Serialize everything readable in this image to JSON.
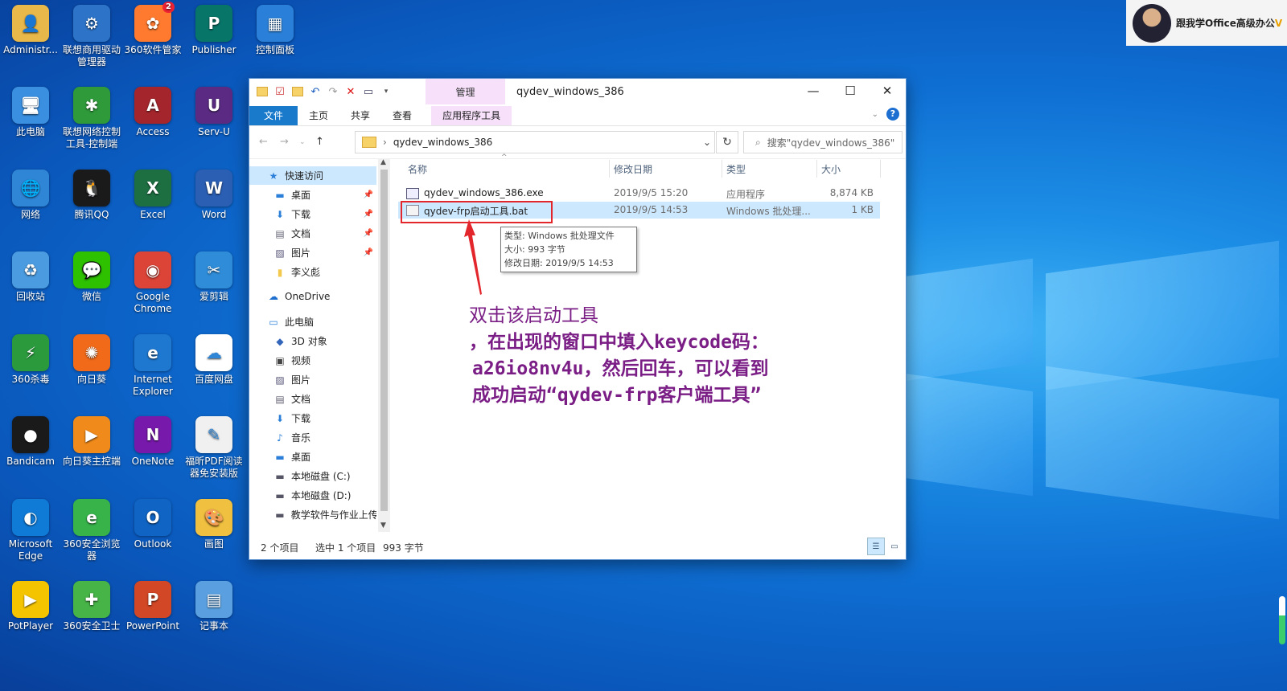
{
  "desktop": {
    "icons": [
      {
        "label": "Administr...",
        "icon": "user-folder-icon",
        "color": "#e9b84a",
        "glyph": "👤"
      },
      {
        "label": "联想商用驱动管理器",
        "icon": "lenovo-driver-icon",
        "color": "#2d74c9",
        "glyph": "⚙"
      },
      {
        "label": "360软件管家",
        "icon": "360-software-manager-icon",
        "color": "#ff7a2f",
        "glyph": "✿",
        "badge": "2"
      },
      {
        "label": "Publisher",
        "icon": "publisher-icon",
        "color": "#077568",
        "glyph": "P"
      },
      {
        "label": "控制面板",
        "icon": "control-panel-icon",
        "color": "#2a80d8",
        "glyph": "▦"
      },
      {
        "label": "此电脑",
        "icon": "this-pc-icon",
        "color": "#3a8fe0",
        "glyph": "🖥"
      },
      {
        "label": "联想网络控制工具-控制端",
        "icon": "lenovo-network-icon",
        "color": "#2e9a3a",
        "glyph": "✱"
      },
      {
        "label": "Access",
        "icon": "access-icon",
        "color": "#a4262c",
        "glyph": "A"
      },
      {
        "label": "Serv-U",
        "icon": "serv-u-icon",
        "color": "#5b2b84",
        "glyph": "U"
      },
      {
        "label": "网络",
        "icon": "network-icon",
        "color": "#2f86d6",
        "glyph": "🌐"
      },
      {
        "label": "腾讯QQ",
        "icon": "qq-icon",
        "color": "#1a1a1a",
        "glyph": "🐧"
      },
      {
        "label": "Excel",
        "icon": "excel-icon",
        "color": "#1d6f42",
        "glyph": "X"
      },
      {
        "label": "Word",
        "icon": "word-icon",
        "color": "#2b5fb4",
        "glyph": "W"
      },
      {
        "label": "回收站",
        "icon": "recycle-bin-icon",
        "color": "#4a9be0",
        "glyph": "♻"
      },
      {
        "label": "微信",
        "icon": "wechat-icon",
        "color": "#2dc100",
        "glyph": "💬"
      },
      {
        "label": "Google Chrome",
        "icon": "chrome-icon",
        "color": "#db4437",
        "glyph": "◉"
      },
      {
        "label": "爱剪辑",
        "icon": "video-editor-icon",
        "color": "#2f8cd8",
        "glyph": "✂"
      },
      {
        "label": "360杀毒",
        "icon": "360-antivirus-icon",
        "color": "#2b9a3d",
        "glyph": "⚡"
      },
      {
        "label": "向日葵",
        "icon": "sunflower-icon",
        "color": "#f06a1a",
        "glyph": "✺"
      },
      {
        "label": "Internet Explorer",
        "icon": "internet-explorer-icon",
        "color": "#1e78d0",
        "glyph": "e"
      },
      {
        "label": "百度网盘",
        "icon": "baidu-netdisk-icon",
        "color": "#ffffff",
        "glyph": "☁"
      },
      {
        "label": "Bandicam",
        "icon": "bandicam-icon",
        "color": "#1a1a1a",
        "glyph": "●"
      },
      {
        "label": "向日葵主控端",
        "icon": "sunflower-controller-icon",
        "color": "#f08a1a",
        "glyph": "▶"
      },
      {
        "label": "OneNote",
        "icon": "onenote-icon",
        "color": "#7719aa",
        "glyph": "N"
      },
      {
        "label": "福昕PDF阅读器免安装版",
        "icon": "foxit-pdf-icon",
        "color": "#f0f0f0",
        "glyph": "✎"
      },
      {
        "label": "Microsoft Edge",
        "icon": "edge-icon",
        "color": "#0f7bd6",
        "glyph": "◐"
      },
      {
        "label": "360安全浏览器",
        "icon": "360-browser-icon",
        "color": "#37b34a",
        "glyph": "e"
      },
      {
        "label": "Outlook",
        "icon": "outlook-icon",
        "color": "#0f64c4",
        "glyph": "O"
      },
      {
        "label": "画图",
        "icon": "paint-icon",
        "color": "#f0c040",
        "glyph": "🎨"
      },
      {
        "label": "PotPlayer",
        "icon": "potplayer-icon",
        "color": "#f5c400",
        "glyph": "▶"
      },
      {
        "label": "360安全卫士",
        "icon": "360-security-icon",
        "color": "#47b447",
        "glyph": "✚"
      },
      {
        "label": "PowerPoint",
        "icon": "powerpoint-icon",
        "color": "#d24726",
        "glyph": "P"
      },
      {
        "label": "记事本",
        "icon": "notepad-icon",
        "color": "#5aa0e0",
        "glyph": "▤"
      }
    ]
  },
  "presenter": {
    "name_main": "跟我学Office高级办公",
    "name_tail": "V"
  },
  "explorer": {
    "title": "qydev_windows_386",
    "context_tab": "管理",
    "tabs": [
      "文件",
      "主页",
      "共享",
      "查看",
      "应用程序工具"
    ],
    "address": "qydev_windows_386",
    "search_placeholder": "搜索\"qydev_windows_386\"",
    "columns": {
      "name": "名称",
      "date": "修改日期",
      "type": "类型",
      "size": "大小"
    },
    "files": [
      {
        "name": "qydev_windows_386.exe",
        "date": "2019/9/5 15:20",
        "type": "应用程序",
        "size": "8,874 KB"
      },
      {
        "name": "qydev-frp启动工具.bat",
        "date": "2019/9/5 14:53",
        "type": "Windows 批处理...",
        "size": "1 KB"
      }
    ],
    "tooltip": {
      "type": "类型: Windows 批处理文件",
      "size": "大小: 993 字节",
      "date": "修改日期: 2019/9/5 14:53"
    },
    "sidebar": [
      {
        "label": "快速访问",
        "icon": "star-icon",
        "pin": false
      },
      {
        "label": "桌面",
        "icon": "desktop-icon",
        "pin": true
      },
      {
        "label": "下载",
        "icon": "download-icon",
        "pin": true
      },
      {
        "label": "文档",
        "icon": "document-icon",
        "pin": true
      },
      {
        "label": "图片",
        "icon": "pictures-icon",
        "pin": true
      },
      {
        "label": "李义彪",
        "icon": "folder-icon",
        "pin": false
      },
      {
        "label": "OneDrive",
        "icon": "onedrive-icon",
        "pin": false
      },
      {
        "label": "此电脑",
        "icon": "computer-icon",
        "pin": false
      },
      {
        "label": "3D 对象",
        "icon": "3d-objects-icon",
        "pin": false
      },
      {
        "label": "视频",
        "icon": "video-icon",
        "pin": false
      },
      {
        "label": "图片",
        "icon": "pictures-icon",
        "pin": false
      },
      {
        "label": "文档",
        "icon": "document-icon",
        "pin": false
      },
      {
        "label": "下载",
        "icon": "download-icon",
        "pin": false
      },
      {
        "label": "音乐",
        "icon": "music-icon",
        "pin": false
      },
      {
        "label": "桌面",
        "icon": "desktop-icon",
        "pin": false
      },
      {
        "label": "本地磁盘 (C:)",
        "icon": "drive-c-icon",
        "pin": false
      },
      {
        "label": "本地磁盘 (D:)",
        "icon": "drive-icon",
        "pin": false
      },
      {
        "label": "教学软件与作业上传",
        "icon": "drive-icon",
        "pin": false
      }
    ],
    "status": {
      "count": "2 个项目",
      "selected": "选中 1 个项目",
      "size": "993 字节"
    }
  },
  "annotation": {
    "lines": [
      "双击该启动工具",
      "，在出现的窗口中填入keycode码：",
      "a26io8nv4u，然后回车，可以看到",
      "成功启动“qydev-frp客户端工具”"
    ],
    "color": "#7a1e86"
  }
}
